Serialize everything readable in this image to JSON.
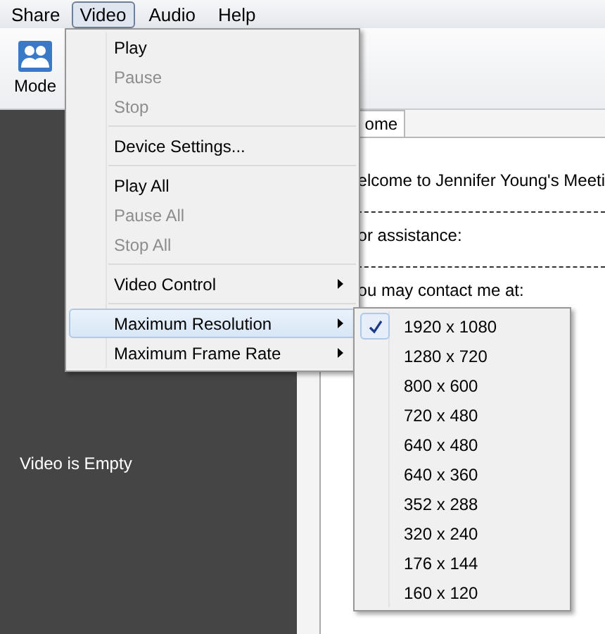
{
  "menubar": [
    {
      "label": "Share",
      "selected": false
    },
    {
      "label": "Video",
      "selected": true
    },
    {
      "label": "Audio",
      "selected": false
    },
    {
      "label": "Help",
      "selected": false
    }
  ],
  "toolbar": {
    "mode_button": "Mode"
  },
  "video_panel": {
    "message": "Video is Empty"
  },
  "content": {
    "tab": "ome",
    "lines": [
      {
        "kind": "text",
        "text": "elcome to Jennifer Young's Meeti"
      },
      {
        "kind": "dashes"
      },
      {
        "kind": "text",
        "text": "or assistance:"
      },
      {
        "kind": "dashes"
      },
      {
        "kind": "text",
        "text": "ou may contact me at:"
      }
    ]
  },
  "video_menu": [
    {
      "kind": "item",
      "label": "Play",
      "disabled": false,
      "submenu": false,
      "selected": false
    },
    {
      "kind": "item",
      "label": "Pause",
      "disabled": true,
      "submenu": false,
      "selected": false
    },
    {
      "kind": "item",
      "label": "Stop",
      "disabled": true,
      "submenu": false,
      "selected": false
    },
    {
      "kind": "separator"
    },
    {
      "kind": "item",
      "label": "Device Settings...",
      "disabled": false,
      "submenu": false,
      "selected": false
    },
    {
      "kind": "separator"
    },
    {
      "kind": "item",
      "label": "Play All",
      "disabled": false,
      "submenu": false,
      "selected": false
    },
    {
      "kind": "item",
      "label": "Pause All",
      "disabled": true,
      "submenu": false,
      "selected": false
    },
    {
      "kind": "item",
      "label": "Stop All",
      "disabled": true,
      "submenu": false,
      "selected": false
    },
    {
      "kind": "separator"
    },
    {
      "kind": "item",
      "label": "Video Control",
      "disabled": false,
      "submenu": true,
      "selected": false
    },
    {
      "kind": "separator"
    },
    {
      "kind": "item",
      "label": "Maximum Resolution",
      "disabled": false,
      "submenu": true,
      "selected": true
    },
    {
      "kind": "item",
      "label": "Maximum Frame Rate",
      "disabled": false,
      "submenu": true,
      "selected": false
    }
  ],
  "resolution_menu": [
    {
      "label": "1920 x 1080",
      "checked": true
    },
    {
      "label": "1280 x 720",
      "checked": false
    },
    {
      "label": "800 x 600",
      "checked": false
    },
    {
      "label": "720 x 480",
      "checked": false
    },
    {
      "label": "640 x 480",
      "checked": false
    },
    {
      "label": "640 x 360",
      "checked": false
    },
    {
      "label": "352 x 288",
      "checked": false
    },
    {
      "label": "320 x 240",
      "checked": false
    },
    {
      "label": "176 x 144",
      "checked": false
    },
    {
      "label": "160 x 120",
      "checked": false
    }
  ]
}
